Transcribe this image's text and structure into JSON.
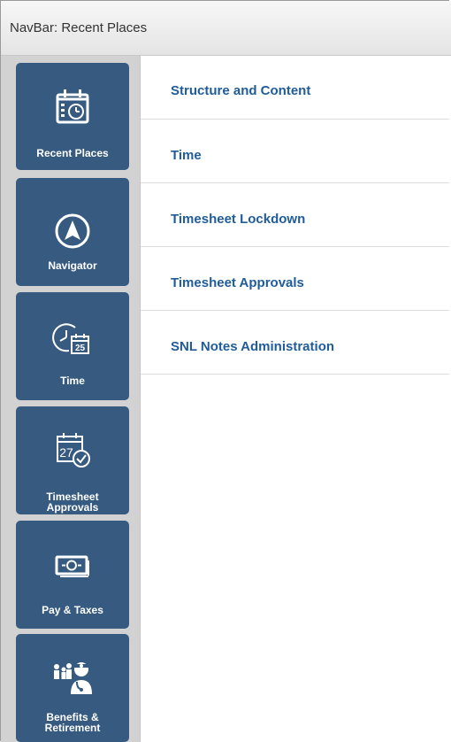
{
  "header": {
    "title": "NavBar: Recent Places"
  },
  "sidebar": {
    "tiles": [
      {
        "label": "Recent Places",
        "icon": "calendar-clock-icon"
      },
      {
        "label": "Navigator",
        "icon": "compass-arrow-icon"
      },
      {
        "label": "Time",
        "icon": "clock-calendar-icon",
        "calendar_day": "25"
      },
      {
        "label": "Timesheet\nApprovals",
        "icon": "calendar-check-icon",
        "calendar_day": "27"
      },
      {
        "label": "Pay & Taxes",
        "icon": "money-icon"
      },
      {
        "label": "Benefits &\nRetirement",
        "icon": "family-doctor-icon"
      }
    ]
  },
  "content": {
    "links": [
      {
        "label": "Structure and Content"
      },
      {
        "label": "Time"
      },
      {
        "label": "Timesheet Lockdown"
      },
      {
        "label": "Timesheet Approvals"
      },
      {
        "label": "SNL Notes Administration"
      }
    ]
  },
  "colors": {
    "tile_bg": "#365a80",
    "link_text": "#1f5c99",
    "header_text": "#333333",
    "sidebar_bg": "#d2d2d2"
  }
}
